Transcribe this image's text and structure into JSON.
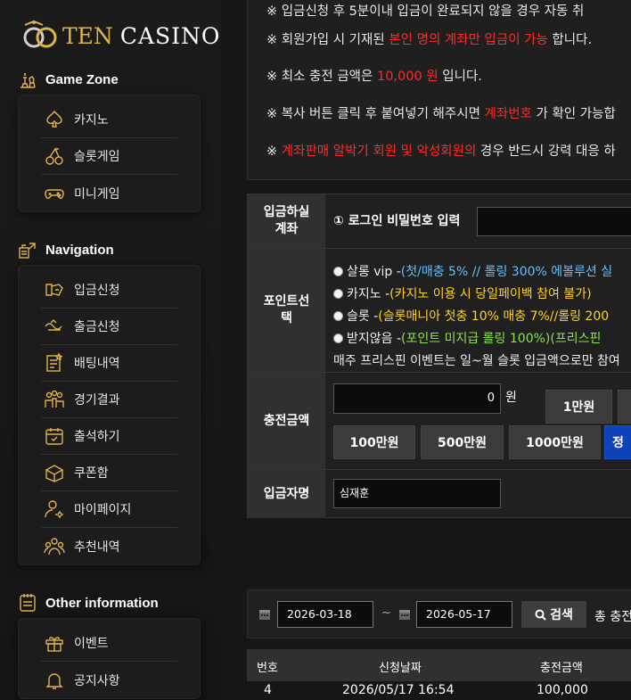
{
  "logo": {
    "ten": "TEN",
    "casino": "CASINO"
  },
  "sidebar": {
    "game_zone": {
      "title": "Game Zone",
      "items": [
        {
          "label": "카지노",
          "icon": "spade-icon"
        },
        {
          "label": "슬롯게임",
          "icon": "cherry-icon"
        },
        {
          "label": "미니게임",
          "icon": "gamepad-icon"
        }
      ]
    },
    "navigation": {
      "title": "Navigation",
      "items": [
        {
          "label": "입금신청",
          "icon": "deposit-icon"
        },
        {
          "label": "출금신청",
          "icon": "withdraw-icon"
        },
        {
          "label": "배팅내역",
          "icon": "betting-history-icon"
        },
        {
          "label": "경기결과",
          "icon": "results-icon"
        },
        {
          "label": "출석하기",
          "icon": "calendar-check-icon"
        },
        {
          "label": "쿠폰함",
          "icon": "coupon-box-icon"
        },
        {
          "label": "마이페이지",
          "icon": "user-settings-icon"
        },
        {
          "label": "추천내역",
          "icon": "referral-icon"
        }
      ]
    },
    "other": {
      "title": "Other information",
      "items": [
        {
          "label": "이벤트",
          "icon": "gift-icon"
        },
        {
          "label": "공지사항",
          "icon": "bell-icon"
        }
      ]
    }
  },
  "notice": {
    "line1": "※ 입금신청 후 5분이내 입금이 완료되지 않을 경우 자동 취",
    "line2": {
      "a": "※ 회원가입 시 기재된 ",
      "b": "본인 명의 계좌만 입금이 가능",
      "c": " 합니다."
    },
    "line3": {
      "a": "※ 최소 충전 금액은 ",
      "b": "10,000 원",
      "c": " 입니다."
    },
    "line4": {
      "a": "※ 복사 버튼 클릭 후 붙여넣기 해주시면 ",
      "b": "계좌번호",
      "c": " 가 확인 가능합"
    },
    "line5": {
      "a": "※ ",
      "b": "계좌판매 알박기 회원 및 악성회원의",
      "c": " 경우 반드시 강력 대응 하"
    }
  },
  "form": {
    "account_label": "입금하실 계좌",
    "pw_label": "① 로그인 비밀번호 입력",
    "point_label": "포인트선택",
    "options": [
      {
        "name": "살롱 vip - ",
        "detail": "(첫/매충 5% // 롤링 300% 에볼루션 실",
        "color": "blue"
      },
      {
        "name": "카지노 - ",
        "detail": "(카지노 이용 시 당일페이백 참여 불가)",
        "color": "yellow"
      },
      {
        "name": "슬롯 - ",
        "detail": "(슬롯매니아 첫충 10% 매충 7%//롤링 200",
        "color": "yellow"
      },
      {
        "name": "받지않음 - ",
        "detail": "(포인트 미지급 롤링 100%)(프리스핀",
        "color": "green"
      }
    ],
    "freespin_note": "매주 프리스핀 이벤트는 일~월 슬롯 입금액으로만 참여",
    "amount_label": "충전금액",
    "amount_value": "0",
    "won": "원",
    "quick_buttons_row1": [
      "1만원"
    ],
    "quick_buttons_row2": [
      "100만원",
      "500만원",
      "1000만원",
      "정"
    ],
    "depositor_label": "입금자명",
    "depositor_value": "심재훈"
  },
  "search": {
    "date_from": "2026-03-18",
    "tilde": "~",
    "date_to": "2026-05-17",
    "button": "검색",
    "total": "총 충전"
  },
  "table": {
    "headers": [
      "번호",
      "신청날짜",
      "충전금액"
    ],
    "rows": [
      {
        "no": "4",
        "date": "2026/05/17 16:54",
        "amount": "100,000"
      }
    ]
  },
  "colors": {
    "accent_gold": "#e0b24a",
    "red": "#ff2a2a",
    "blue_button": "#1143b8"
  }
}
